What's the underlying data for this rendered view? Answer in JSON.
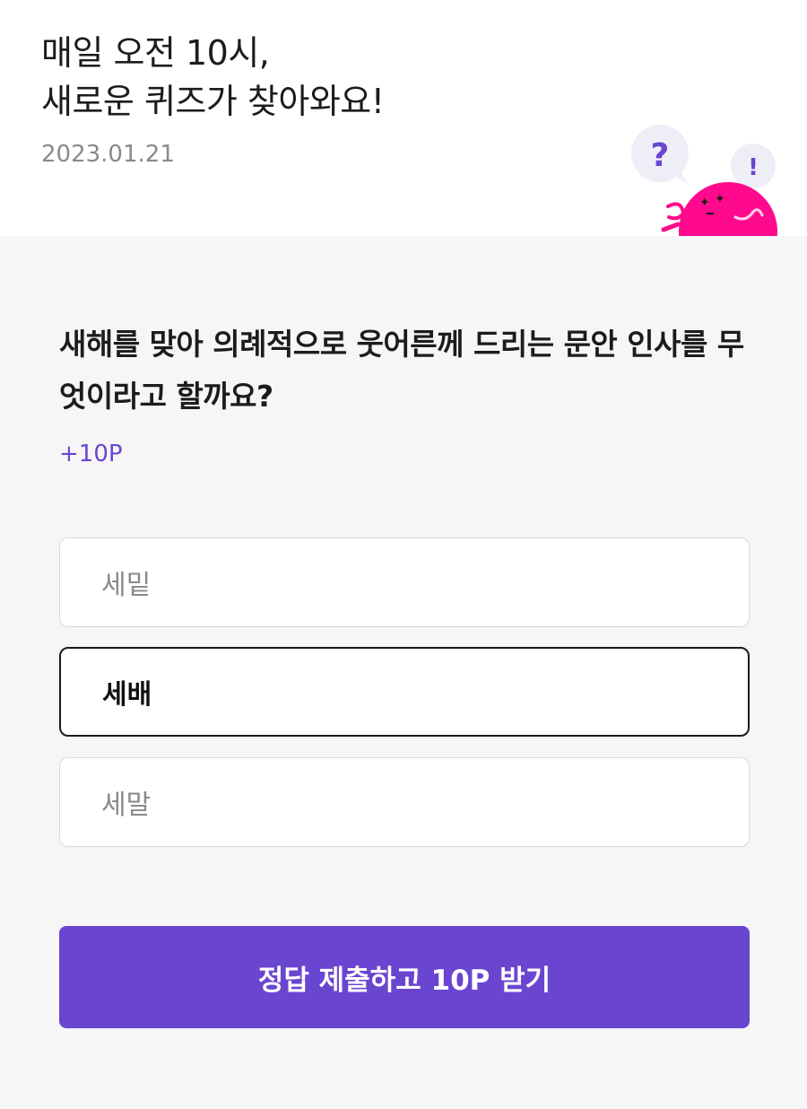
{
  "header": {
    "title_line1": "매일 오전 10시,",
    "title_line2": "새로운 퀴즈가 찾아와요!",
    "date": "2023.01.21",
    "mascot": {
      "question_mark": "?",
      "exclamation_mark": "!"
    }
  },
  "quiz": {
    "question": "새해를 맞아 의례적으로 웃어른께 드리는 문안 인사를 무엇이라고 할까요?",
    "points": "+10P",
    "options": [
      {
        "label": "세밑",
        "selected": false
      },
      {
        "label": "세배",
        "selected": true
      },
      {
        "label": "세말",
        "selected": false
      }
    ],
    "submit_label": "정답 제출하고 10P 받기"
  },
  "colors": {
    "accent": "#6a45d0",
    "mascot_pink": "#ff0a8c",
    "bubble": "#eeeef6",
    "background": "#f6f6f6"
  }
}
